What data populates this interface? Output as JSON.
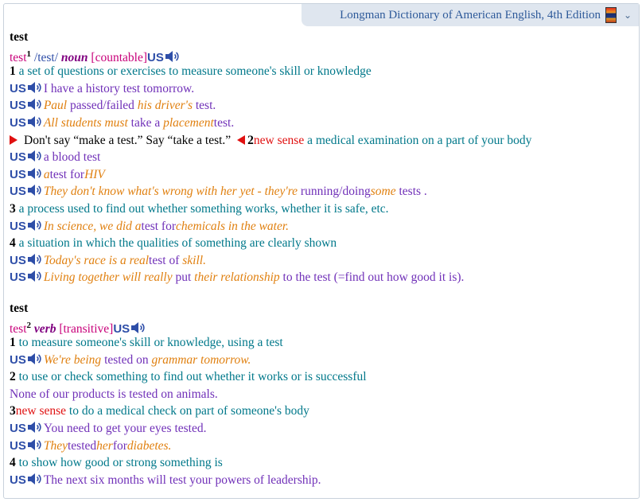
{
  "window": {
    "title": "Longman Dictionary of American English, 4th Edition"
  },
  "entry1": {
    "headword": "test",
    "word": "test",
    "homograph": "1",
    "pron": "/test/",
    "pos": "noun",
    "gram": "[countable]",
    "us": "US",
    "sense1": {
      "num": "1",
      "def": "a set of questions or exercises to measure someone's skill or knowledge",
      "ex1": "I have a history test tomorrow.",
      "ex2": {
        "a": "Paul",
        "b": " passed/failed ",
        "c": "his driver's",
        "d": " test."
      },
      "ex3": {
        "a": "All students must",
        "b": " take a ",
        "c": "placement",
        "d": "test."
      },
      "note": "Don't say “make a test.” Say “take a test.”"
    },
    "sense2": {
      "num": "2",
      "new": "new sense",
      "def": " a medical examination on a part of your body",
      "ex1": "a blood test",
      "ex2": {
        "a": "a",
        "b": "test for",
        "c": "HIV"
      },
      "ex3": {
        "a": "They don't know what's wrong with her yet - they're",
        "b": " running/doing",
        "c": "some",
        "d": " tests ."
      }
    },
    "sense3": {
      "num": "3",
      "def": "a process used to find out whether something works, whether it is safe, etc.",
      "ex1": {
        "a": "In science, we did a",
        "b": "test for",
        "c": "chemicals in the water."
      }
    },
    "sense4": {
      "num": "4",
      "def": "a situation in which the qualities of something are clearly shown",
      "ex1": {
        "a": "Today's race is a real",
        "b": "test of ",
        "c": "skill."
      },
      "ex2": {
        "a": "Living together will really",
        "b": " put ",
        "c": "their relationship",
        "d": " to the test (=find out how good it is)."
      }
    }
  },
  "entry2": {
    "headword": "test",
    "word": "test",
    "homograph": "2",
    "pos": "verb",
    "gram": "[transitive]",
    "us": "US",
    "sense1": {
      "num": "1",
      "def": "to measure someone's skill or knowledge, using a test",
      "ex1": {
        "a": "We're being",
        "b": " tested on ",
        "c": "grammar tomorrow."
      }
    },
    "sense2": {
      "num": "2",
      "def": "to use or check something to find out whether it works or is successful",
      "ex1": "None of our products is tested on animals."
    },
    "sense3": {
      "num": "3",
      "new": "new sense",
      "def": " to do a medical check on part of someone's body",
      "ex1": "You need to get your eyes tested.",
      "ex2": {
        "a": "They",
        "b": "tested",
        "c": "her",
        "d": "for",
        "e": "diabetes."
      }
    },
    "sense4": {
      "num": "4",
      "def": "to show how good or strong something is",
      "ex1": "The next six months will test your powers of leadership."
    }
  }
}
